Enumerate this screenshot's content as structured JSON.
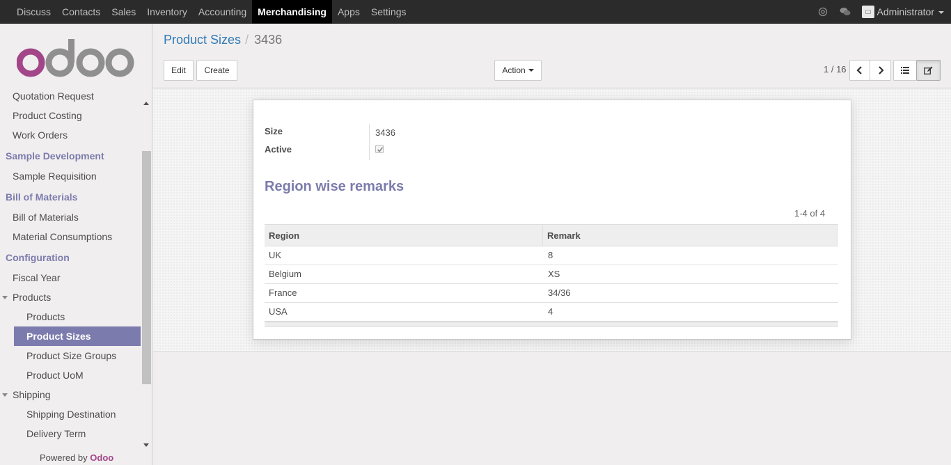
{
  "topbar": {
    "menu": [
      "Discuss",
      "Contacts",
      "Sales",
      "Inventory",
      "Accounting",
      "Merchandising",
      "Apps",
      "Settings"
    ],
    "active": "Merchandising",
    "user": "Administrator"
  },
  "sidebar": {
    "logo_text": "odoo",
    "items": [
      {
        "type": "item",
        "label": "Quotation Request"
      },
      {
        "type": "item",
        "label": "Product Costing"
      },
      {
        "type": "item",
        "label": "Work Orders"
      },
      {
        "type": "header",
        "label": "Sample Development"
      },
      {
        "type": "item",
        "label": "Sample Requisition"
      },
      {
        "type": "header",
        "label": "Bill of Materials"
      },
      {
        "type": "item",
        "label": "Bill of Materials"
      },
      {
        "type": "item",
        "label": "Material Consumptions"
      },
      {
        "type": "header",
        "label": "Configuration"
      },
      {
        "type": "item",
        "label": "Fiscal Year"
      },
      {
        "type": "toggle",
        "label": "Products"
      },
      {
        "type": "sub",
        "label": "Products"
      },
      {
        "type": "sub",
        "label": "Product Sizes",
        "active": true
      },
      {
        "type": "sub",
        "label": "Product Size Groups"
      },
      {
        "type": "sub",
        "label": "Product UoM"
      },
      {
        "type": "toggle",
        "label": "Shipping"
      },
      {
        "type": "sub",
        "label": "Shipping Destination"
      },
      {
        "type": "sub",
        "label": "Delivery Term"
      }
    ],
    "powered_prefix": "Powered by",
    "powered_brand": "Odoo"
  },
  "control": {
    "breadcrumb_parent": "Product Sizes",
    "breadcrumb_current": "3436",
    "edit_label": "Edit",
    "create_label": "Create",
    "action_label": "Action",
    "pager": "1 / 16"
  },
  "form": {
    "size_label": "Size",
    "size_value": "3436",
    "active_label": "Active",
    "active_checked": true,
    "section_title": "Region wise remarks",
    "list_pager": "1-4 of 4",
    "columns": [
      "Region",
      "Remark"
    ],
    "rows": [
      [
        "UK",
        "8"
      ],
      [
        "Belgium",
        "XS"
      ],
      [
        "France",
        "34/36"
      ],
      [
        "USA",
        "4"
      ]
    ]
  },
  "colors": {
    "accent": "#7c7bad",
    "topbar": "#2b2b2b",
    "brand": "#a24689",
    "link": "#337ab7"
  }
}
